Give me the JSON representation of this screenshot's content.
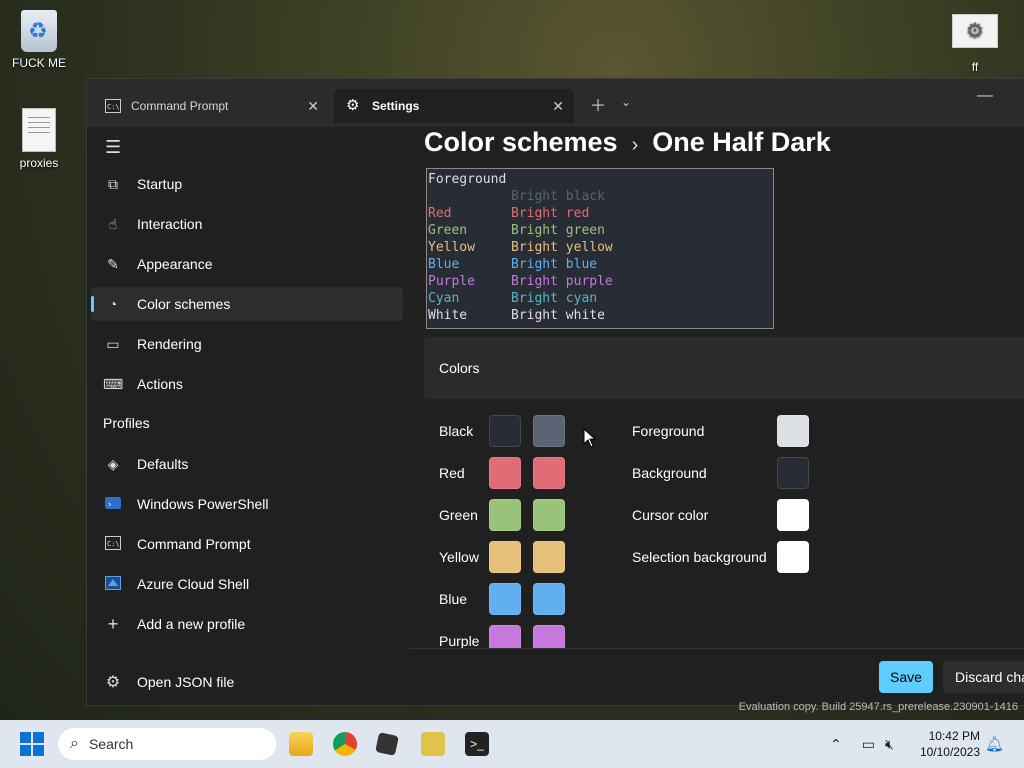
{
  "desktop": {
    "recycle_label": "FUCK ME",
    "proxies_label": "proxies",
    "ff_label": "ff",
    "ff_icon": "gear-icon"
  },
  "tabs": [
    {
      "label": "Command Prompt",
      "icon": "cmd-icon"
    },
    {
      "label": "Settings",
      "icon": "gear-icon"
    }
  ],
  "sidebar": {
    "items": [
      {
        "label": "Startup",
        "icon": "startup-icon"
      },
      {
        "label": "Interaction",
        "icon": "interaction-icon"
      },
      {
        "label": "Appearance",
        "icon": "brush-icon"
      },
      {
        "label": "Color schemes",
        "icon": "palette-icon"
      },
      {
        "label": "Rendering",
        "icon": "monitor-icon"
      },
      {
        "label": "Actions",
        "icon": "keyboard-icon"
      }
    ],
    "profiles_header": "Profiles",
    "profiles": [
      {
        "label": "Defaults",
        "icon": "layers-icon"
      },
      {
        "label": "Windows PowerShell",
        "icon": "powershell-icon"
      },
      {
        "label": "Command Prompt",
        "icon": "cmd-icon"
      },
      {
        "label": "Azure Cloud Shell",
        "icon": "azure-icon"
      },
      {
        "label": "Add a new profile",
        "icon": "plus-icon"
      }
    ],
    "open_json": "Open JSON file"
  },
  "breadcrumb": {
    "parent": "Color schemes",
    "current": "One Half Dark"
  },
  "preview": {
    "foreground_label": "Foreground",
    "rows": [
      {
        "normal": "",
        "bright": "Bright black",
        "ncolor": "#dcdfe4",
        "bcolor": "#5a6374"
      },
      {
        "normal": "Red",
        "bright": "Bright red",
        "ncolor": "#e06c75",
        "bcolor": "#e06c75"
      },
      {
        "normal": "Green",
        "bright": "Bright green",
        "ncolor": "#98c379",
        "bcolor": "#98c379"
      },
      {
        "normal": "Yellow",
        "bright": "Bright yellow",
        "ncolor": "#e5c07b",
        "bcolor": "#e5c07b"
      },
      {
        "normal": "Blue",
        "bright": "Bright blue",
        "ncolor": "#61afef",
        "bcolor": "#61afef"
      },
      {
        "normal": "Purple",
        "bright": "Bright purple",
        "ncolor": "#c678dd",
        "bcolor": "#c678dd"
      },
      {
        "normal": "Cyan",
        "bright": "Bright cyan",
        "ncolor": "#56b6c2",
        "bcolor": "#56b6c2"
      },
      {
        "normal": "White",
        "bright": "Bright white",
        "ncolor": "#dcdfe4",
        "bcolor": "#dcdfe4"
      }
    ]
  },
  "colors_section": {
    "title": "Colors"
  },
  "color_rows": [
    {
      "label": "Black",
      "normal": "#282c34",
      "bright": "#5a6374"
    },
    {
      "label": "Red",
      "normal": "#e06c75",
      "bright": "#e06c75"
    },
    {
      "label": "Green",
      "normal": "#98c379",
      "bright": "#98c379"
    },
    {
      "label": "Yellow",
      "normal": "#e5c07b",
      "bright": "#e5c07b"
    },
    {
      "label": "Blue",
      "normal": "#61afef",
      "bright": "#61afef"
    },
    {
      "label": "Purple",
      "normal": "#c678dd",
      "bright": "#c678dd"
    }
  ],
  "right_rows": [
    {
      "label": "Foreground",
      "color": "#dcdfe4"
    },
    {
      "label": "Background",
      "color": "#282c34"
    },
    {
      "label": "Cursor color",
      "color": "#ffffff"
    },
    {
      "label": "Selection background",
      "color": "#ffffff"
    }
  ],
  "buttons": {
    "save": "Save",
    "discard": "Discard cha"
  },
  "watermark": "Evaluation copy. Build 25947.rs_prerelease.230901-1416",
  "taskbar": {
    "search_placeholder": "Search",
    "time": "10:42 PM",
    "date": "10/10/2023"
  },
  "colors": {
    "accent": "#60cdff"
  }
}
